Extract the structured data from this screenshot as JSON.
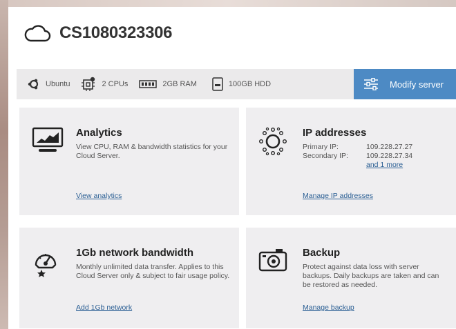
{
  "server": {
    "name": "CS1080323306"
  },
  "specs": {
    "os": "Ubuntu",
    "cpus": "2 CPUs",
    "ram": "2GB RAM",
    "hdd": "100GB HDD",
    "modify_label": "Modify server"
  },
  "cards": {
    "analytics": {
      "title": "Analytics",
      "description": "View CPU, RAM & bandwidth statistics for your Cloud Server.",
      "link": "View analytics"
    },
    "ip": {
      "title": "IP addresses",
      "primary_label": "Primary IP:",
      "primary_value": "109.228.27.27",
      "secondary_label": "Secondary IP:",
      "secondary_value": "109.228.27.34",
      "more_link": "and 1 more",
      "link": "Manage IP addresses"
    },
    "bandwidth": {
      "title": "1Gb network bandwidth",
      "description": "Monthly unlimited data transfer. Applies to this Cloud Server only & subject to fair usage policy.",
      "link": "Add 1Gb network"
    },
    "backup": {
      "title": "Backup",
      "description": "Protect against data loss with server backups. Daily backups are taken and can be restored as needed.",
      "link": "Manage backup"
    }
  },
  "colors": {
    "accent": "#4d8ac4",
    "link": "#2b5f94",
    "card_bg": "#efeef0",
    "bar_bg": "#ebeaeb"
  }
}
